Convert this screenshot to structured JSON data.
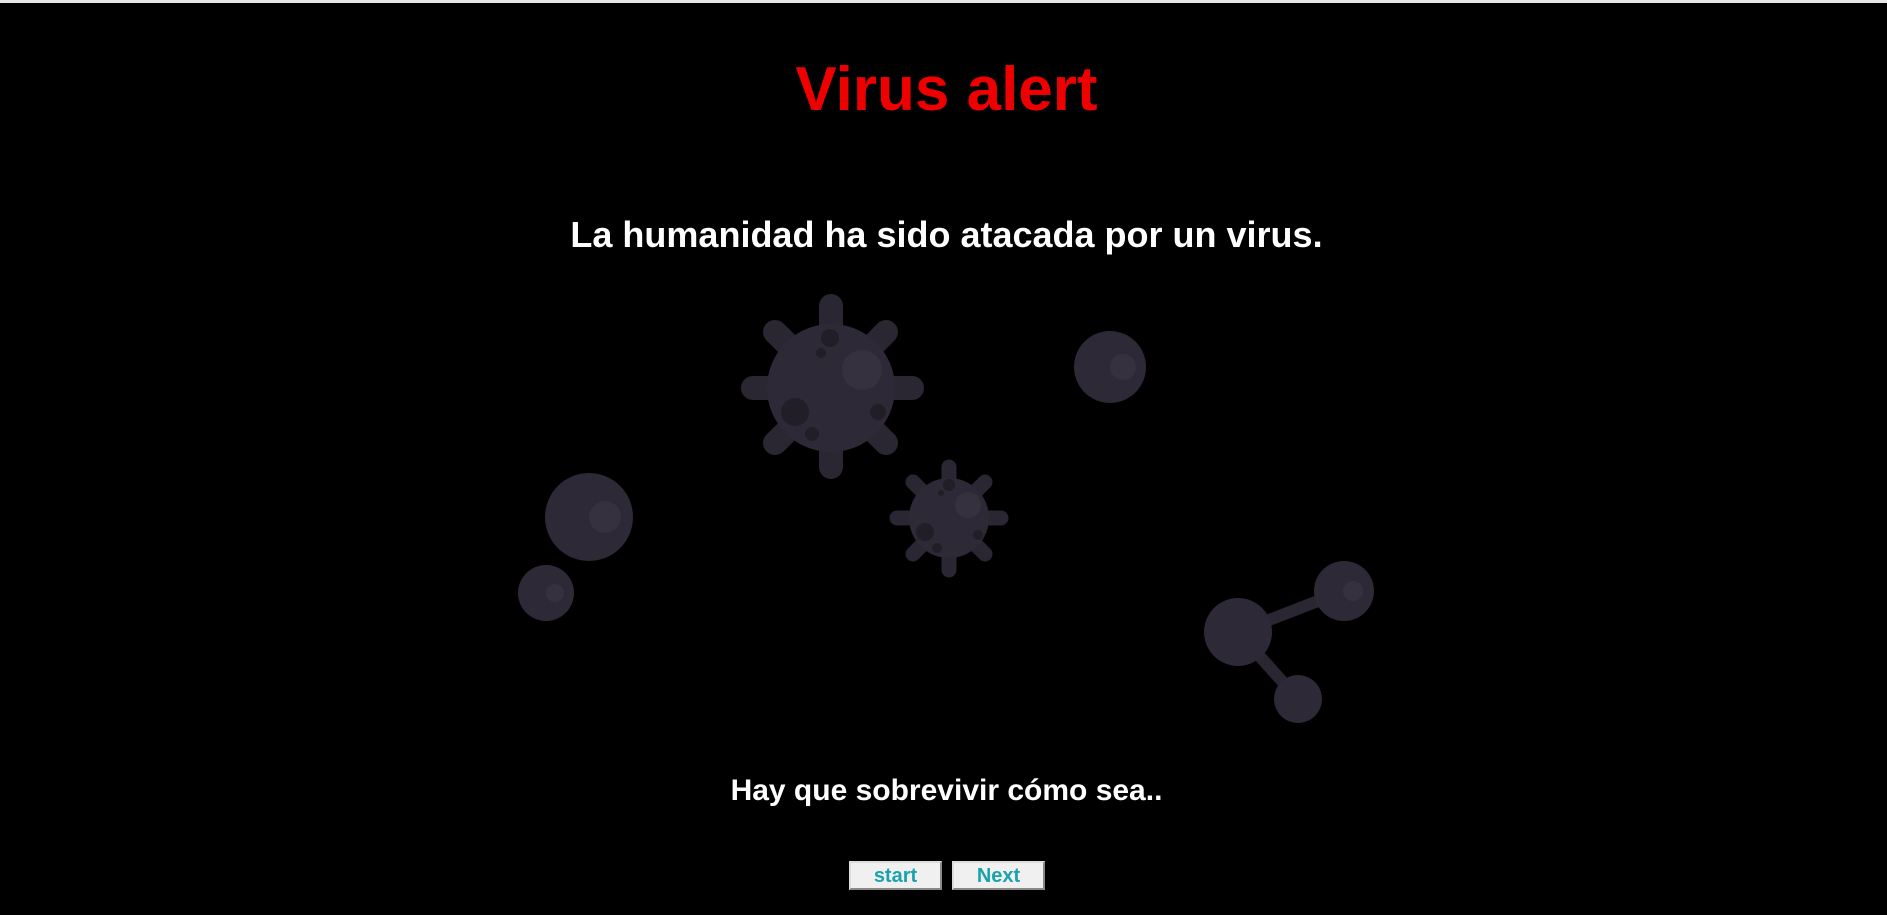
{
  "header": {
    "title": "Virus alert"
  },
  "main": {
    "subtitle": "La humanidad ha sido atacada por un virus.",
    "tagline": "Hay que sobrevivir cómo sea.."
  },
  "buttons": {
    "start_label": "start",
    "next_label": "Next"
  },
  "colors": {
    "background": "#000000",
    "title": "#ee0000",
    "text": "#ffffff",
    "button_text": "#1aa3ad",
    "illustration": "#28242f"
  },
  "illustration": {
    "description_icons": [
      "large-virus-icon",
      "small-virus-icon",
      "cell-icon",
      "molecule-icon"
    ]
  }
}
